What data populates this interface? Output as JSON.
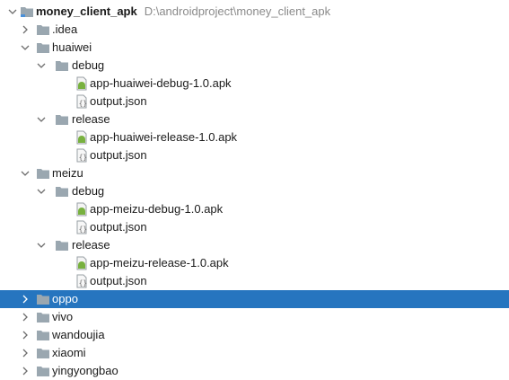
{
  "root": {
    "name": "money_client_apk",
    "path": "D:\\androidproject\\money_client_apk"
  },
  "items": [
    {
      "label": ".idea"
    },
    {
      "label": "huaiwei"
    },
    {
      "label": "debug"
    },
    {
      "label": "app-huaiwei-debug-1.0.apk"
    },
    {
      "label": "output.json"
    },
    {
      "label": "release"
    },
    {
      "label": "app-huaiwei-release-1.0.apk"
    },
    {
      "label": "output.json"
    },
    {
      "label": "meizu"
    },
    {
      "label": "debug"
    },
    {
      "label": "app-meizu-debug-1.0.apk"
    },
    {
      "label": "output.json"
    },
    {
      "label": "release"
    },
    {
      "label": "app-meizu-release-1.0.apk"
    },
    {
      "label": "output.json"
    },
    {
      "label": "oppo"
    },
    {
      "label": "vivo"
    },
    {
      "label": "wandoujia"
    },
    {
      "label": "xiaomi"
    },
    {
      "label": "yingyongbao"
    }
  ],
  "colors": {
    "selection": "#2675bf",
    "folder": "#9aa7b0",
    "apk": "#78b13f",
    "path": "#8a8a8a"
  },
  "icons": [
    "chevron-right-icon",
    "chevron-down-icon",
    "folder-icon",
    "apk-file-icon",
    "json-file-icon"
  ]
}
